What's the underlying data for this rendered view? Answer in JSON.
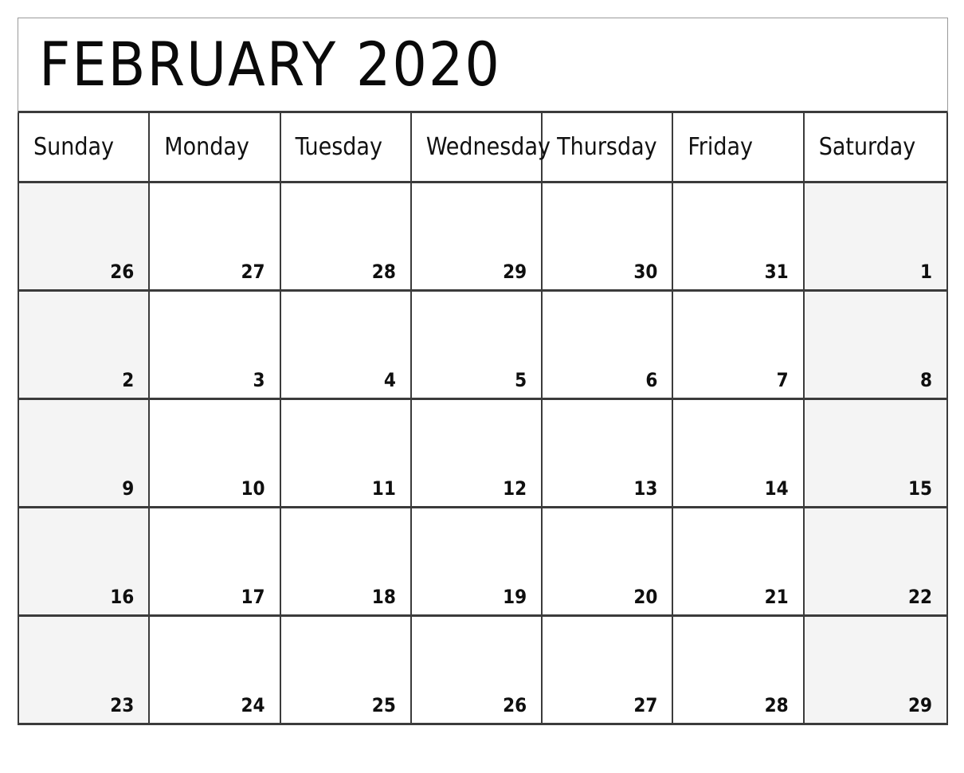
{
  "calendar": {
    "title": "FEBRUARY 2020",
    "month": "February",
    "year": "2020",
    "weekday_headers": [
      "Sunday",
      "Monday",
      "Tuesday",
      "Wednesday",
      "Thursday",
      "Friday",
      "Saturday"
    ],
    "weeks": [
      [
        "26",
        "27",
        "28",
        "29",
        "30",
        "31",
        "1"
      ],
      [
        "2",
        "3",
        "4",
        "5",
        "6",
        "7",
        "8"
      ],
      [
        "9",
        "10",
        "11",
        "12",
        "13",
        "14",
        "15"
      ],
      [
        "16",
        "17",
        "18",
        "19",
        "20",
        "21",
        "22"
      ],
      [
        "23",
        "24",
        "25",
        "26",
        "27",
        "28",
        "29"
      ]
    ],
    "weekend_column_indices": [
      0,
      6
    ],
    "colors": {
      "page_background": "#ffffff",
      "cell_background": "#ffffff",
      "weekend_background": "#f4f4f4",
      "grid_line": "#3b3b3b",
      "title_border": "#9a9a9a",
      "title_text": "#0a0a0a",
      "header_text": "#111111",
      "date_text": "#0f0f0f"
    }
  }
}
